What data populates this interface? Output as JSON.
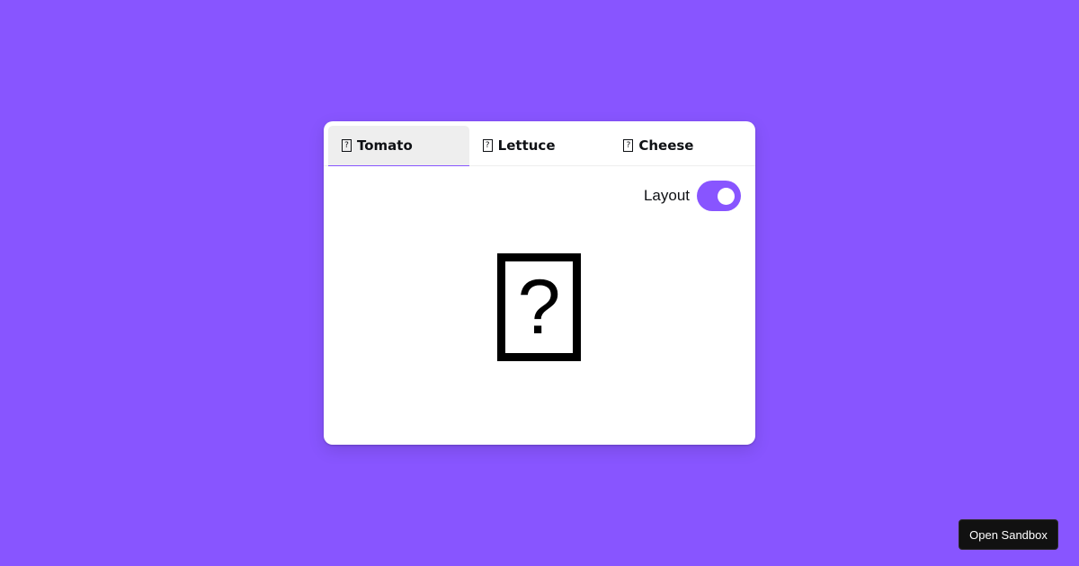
{
  "tabs": [
    {
      "icon": "?",
      "icon_name": "missing-glyph-icon",
      "label": "Tomato",
      "selected": true
    },
    {
      "icon": "?",
      "icon_name": "missing-glyph-icon",
      "label": "Lettuce",
      "selected": false
    },
    {
      "icon": "?",
      "icon_name": "missing-glyph-icon",
      "label": "Cheese",
      "selected": false
    }
  ],
  "toggle": {
    "label": "Layout",
    "on": true
  },
  "content": {
    "glyph": "?",
    "icon_name": "missing-glyph-icon"
  },
  "sandbox_button": {
    "label": "Open Sandbox"
  },
  "colors": {
    "background": "#8855ff",
    "accent": "#8855ff",
    "selected_tab": "#eeeeee"
  }
}
